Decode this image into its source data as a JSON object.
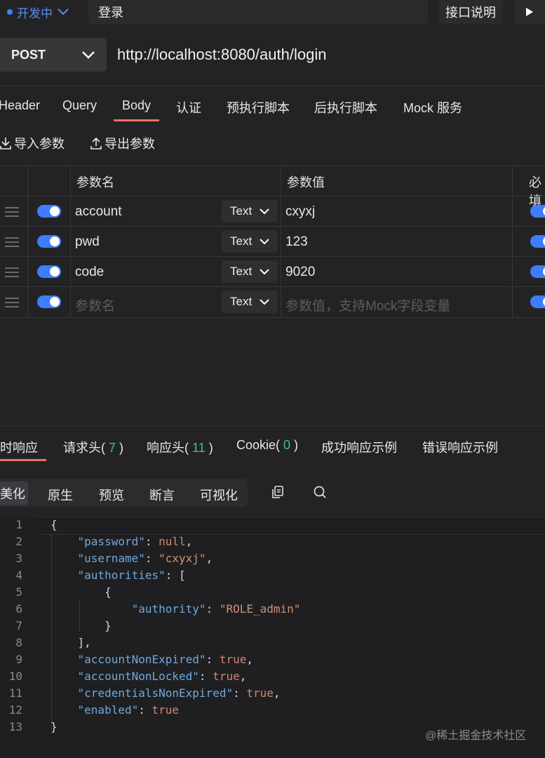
{
  "topbar": {
    "env_label": "开发中",
    "tab_title": "登录",
    "doc_button": "接口说明"
  },
  "request": {
    "method": "POST",
    "url": "http://localhost:8080/auth/login"
  },
  "request_tabs": [
    "Header",
    "Query",
    "Body",
    "认证",
    "预执行脚本",
    "后执行脚本",
    "Mock 服务"
  ],
  "active_request_tab": "Body",
  "body_actions": {
    "import": "导入参数",
    "export": "导出参数"
  },
  "params": {
    "headers": {
      "name": "参数名",
      "value": "参数值",
      "required": "必填"
    },
    "rows": [
      {
        "name": "account",
        "type": "Text",
        "value": "cxyxj",
        "enabled": true,
        "required": true
      },
      {
        "name": "pwd",
        "type": "Text",
        "value": "123",
        "enabled": true,
        "required": true
      },
      {
        "name": "code",
        "type": "Text",
        "value": "9020",
        "enabled": true,
        "required": true
      }
    ],
    "new_row": {
      "name_placeholder": "参数名",
      "type": "Text",
      "value_placeholder": "参数值，支持Mock字段变量"
    }
  },
  "response_tabs": [
    {
      "label": "实时响应"
    },
    {
      "label": "请求头",
      "count": "7"
    },
    {
      "label": "响应头",
      "count": "11"
    },
    {
      "label": "Cookie",
      "count": "0"
    },
    {
      "label": "成功响应示例"
    },
    {
      "label": "错误响应示例"
    }
  ],
  "view_modes": [
    "美化",
    "原生",
    "预览",
    "断言",
    "可视化"
  ],
  "active_view_mode": "美化",
  "code_lines": [
    {
      "n": "1",
      "t": "{"
    },
    {
      "n": "2",
      "t": "    \"password\": null,"
    },
    {
      "n": "3",
      "t": "    \"username\": \"cxyxj\","
    },
    {
      "n": "4",
      "t": "    \"authorities\": ["
    },
    {
      "n": "5",
      "t": "        {"
    },
    {
      "n": "6",
      "t": "            \"authority\": \"ROLE_admin\""
    },
    {
      "n": "7",
      "t": "        }"
    },
    {
      "n": "8",
      "t": "    ],"
    },
    {
      "n": "9",
      "t": "    \"accountNonExpired\": true,"
    },
    {
      "n": "10",
      "t": "    \"accountNonLocked\": true,"
    },
    {
      "n": "11",
      "t": "    \"credentialsNonExpired\": true,"
    },
    {
      "n": "12",
      "t": "    \"enabled\": true"
    },
    {
      "n": "13",
      "t": "}"
    }
  ],
  "watermark": "@稀土掘金技术社区",
  "colors": {
    "accent": "#e8715a",
    "toggle": "#3f7dff",
    "count": "#3cc47c"
  }
}
